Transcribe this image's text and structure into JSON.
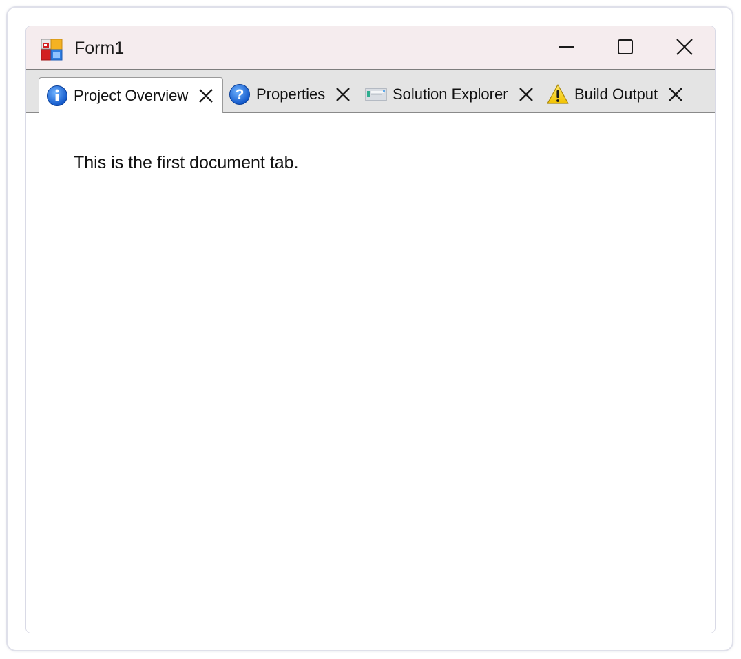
{
  "window": {
    "title": "Form1",
    "icon": "windows-form-icon",
    "controls": {
      "minimize": "minimize-icon",
      "maximize": "maximize-icon",
      "close": "close-icon"
    }
  },
  "tabs": [
    {
      "label": "Project Overview",
      "icon": "info-icon",
      "active": true
    },
    {
      "label": "Properties",
      "icon": "help-icon",
      "active": false
    },
    {
      "label": "Solution Explorer",
      "icon": "window-icon",
      "active": false
    },
    {
      "label": "Build Output",
      "icon": "warning-icon",
      "active": false
    }
  ],
  "content": {
    "text": "This is the first document tab."
  },
  "colors": {
    "titlebar": "#f5ecee",
    "tabstrip": "#e4e4e4",
    "info_blue": "#1f6fd6",
    "warning_yellow": "#f7d317"
  }
}
